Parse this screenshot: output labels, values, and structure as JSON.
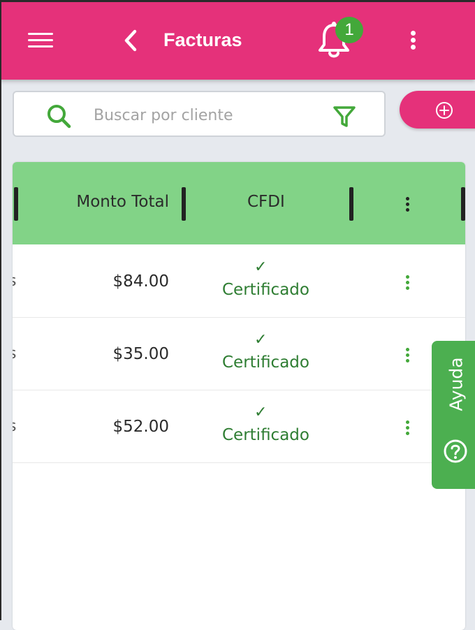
{
  "header": {
    "title": "Facturas",
    "notification_count": "1",
    "menu_icon": "hamburger-icon",
    "back_icon": "chevron-left-icon",
    "bell_icon": "bell-icon",
    "more_icon": "vertical-dots-icon"
  },
  "search": {
    "placeholder": "Buscar por cliente",
    "value": ""
  },
  "colors": {
    "primary": "#e5317a",
    "header_row": "#82d387",
    "success": "#43a83a",
    "help_tab": "#4caf50"
  },
  "table": {
    "columns": [
      "Monto Total",
      "CFDI"
    ],
    "rows": [
      {
        "edge": "s",
        "amount": "$84.00",
        "check": "✓",
        "status": "Certificado"
      },
      {
        "edge": "s",
        "amount": "$35.00",
        "check": "✓",
        "status": "Certificado"
      },
      {
        "edge": "s",
        "amount": "$52.00",
        "check": "✓",
        "status": "Certificado"
      }
    ]
  },
  "help": {
    "label": "Ayuda",
    "icon": "question-circle-icon"
  }
}
